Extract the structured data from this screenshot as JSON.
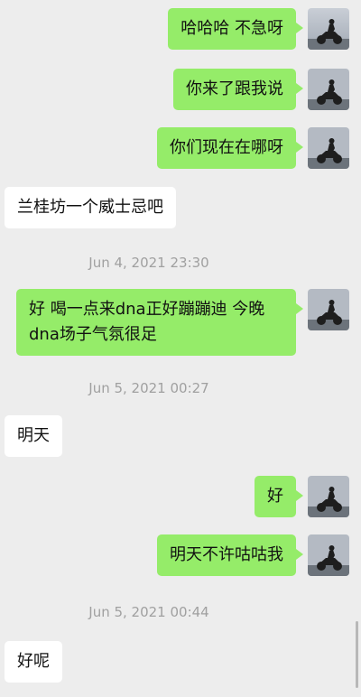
{
  "messages": [
    {
      "kind": "msg",
      "side": "me",
      "text": "哈哈哈 不急呀"
    },
    {
      "kind": "msg",
      "side": "me",
      "text": "你来了跟我说"
    },
    {
      "kind": "msg",
      "side": "me",
      "text": "你们现在在哪呀"
    },
    {
      "kind": "msg",
      "side": "them",
      "text": "兰桂坊一个威士忌吧"
    },
    {
      "kind": "time",
      "text": "Jun 4, 2021 23:30"
    },
    {
      "kind": "msg",
      "side": "me",
      "text": "好 喝一点来dna正好蹦蹦迪 今晚\ndna场子气氛很足"
    },
    {
      "kind": "time",
      "text": "Jun 5, 2021 00:27"
    },
    {
      "kind": "msg",
      "side": "them",
      "text": "明天"
    },
    {
      "kind": "msg",
      "side": "me",
      "text": "好"
    },
    {
      "kind": "msg",
      "side": "me",
      "text": "明天不许咕咕我"
    },
    {
      "kind": "time",
      "text": "Jun 5, 2021 00:44"
    },
    {
      "kind": "msg",
      "side": "them",
      "text": "好呢"
    }
  ],
  "icons": {
    "avatar": "motorcycle-rider-silhouette"
  },
  "colors": {
    "background": "#ededed",
    "my_bubble": "#95ec69",
    "their_bubble": "#ffffff",
    "timestamp_text": "#a0a0a0"
  }
}
